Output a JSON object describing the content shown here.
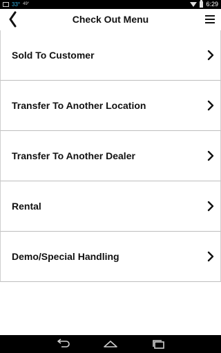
{
  "status_bar": {
    "temperature": "33°",
    "temperature_small": "49°",
    "time": "6:29"
  },
  "header": {
    "title": "Check Out Menu"
  },
  "menu": {
    "items": [
      {
        "label": "Sold To Customer"
      },
      {
        "label": "Transfer To Another Location"
      },
      {
        "label": "Transfer To Another Dealer"
      },
      {
        "label": "Rental"
      },
      {
        "label": "Demo/Special Handling"
      }
    ]
  },
  "icons": {
    "back": "chevron-left-icon",
    "menu": "hamburger-menu-icon",
    "item_arrow": "chevron-right-icon",
    "nav_back": "back-arrow-icon",
    "nav_home": "home-icon",
    "nav_recent": "recent-apps-icon"
  },
  "colors": {
    "status_accent": "#33b5e5",
    "text": "#111111",
    "divider": "#cfcfcf",
    "bars": "#000000"
  }
}
